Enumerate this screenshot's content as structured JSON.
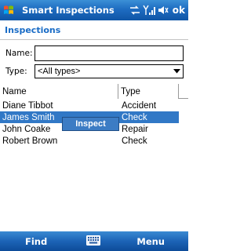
{
  "titlebar": {
    "title": "Smart Inspections",
    "ok_label": "ok",
    "icons": [
      "windows-start-icon",
      "connectivity-icon",
      "signal-icon",
      "speaker-icon"
    ]
  },
  "page": {
    "header": "Inspections"
  },
  "form": {
    "name_label": "Name:",
    "name_value": "",
    "type_label": "Type:",
    "type_value": "<All types>"
  },
  "list": {
    "columns": [
      "Name",
      "Type"
    ],
    "rows": [
      {
        "name": "Diane Tibbot",
        "type": "Accident"
      },
      {
        "name": "James Smith",
        "type": "Check"
      },
      {
        "name": "John Coake",
        "type": "Repair"
      },
      {
        "name": "Robert Brown",
        "type": "Check"
      }
    ],
    "selected_index": 1
  },
  "popup": {
    "inspect_label": "Inspect"
  },
  "menubar": {
    "left_label": "Find",
    "right_label": "Menu",
    "keyboard_icon": "keyboard-icon"
  },
  "colors": {
    "accent": "#1a6cc6",
    "titlebar": "#1e6cc1",
    "selection": "#3178c6"
  }
}
